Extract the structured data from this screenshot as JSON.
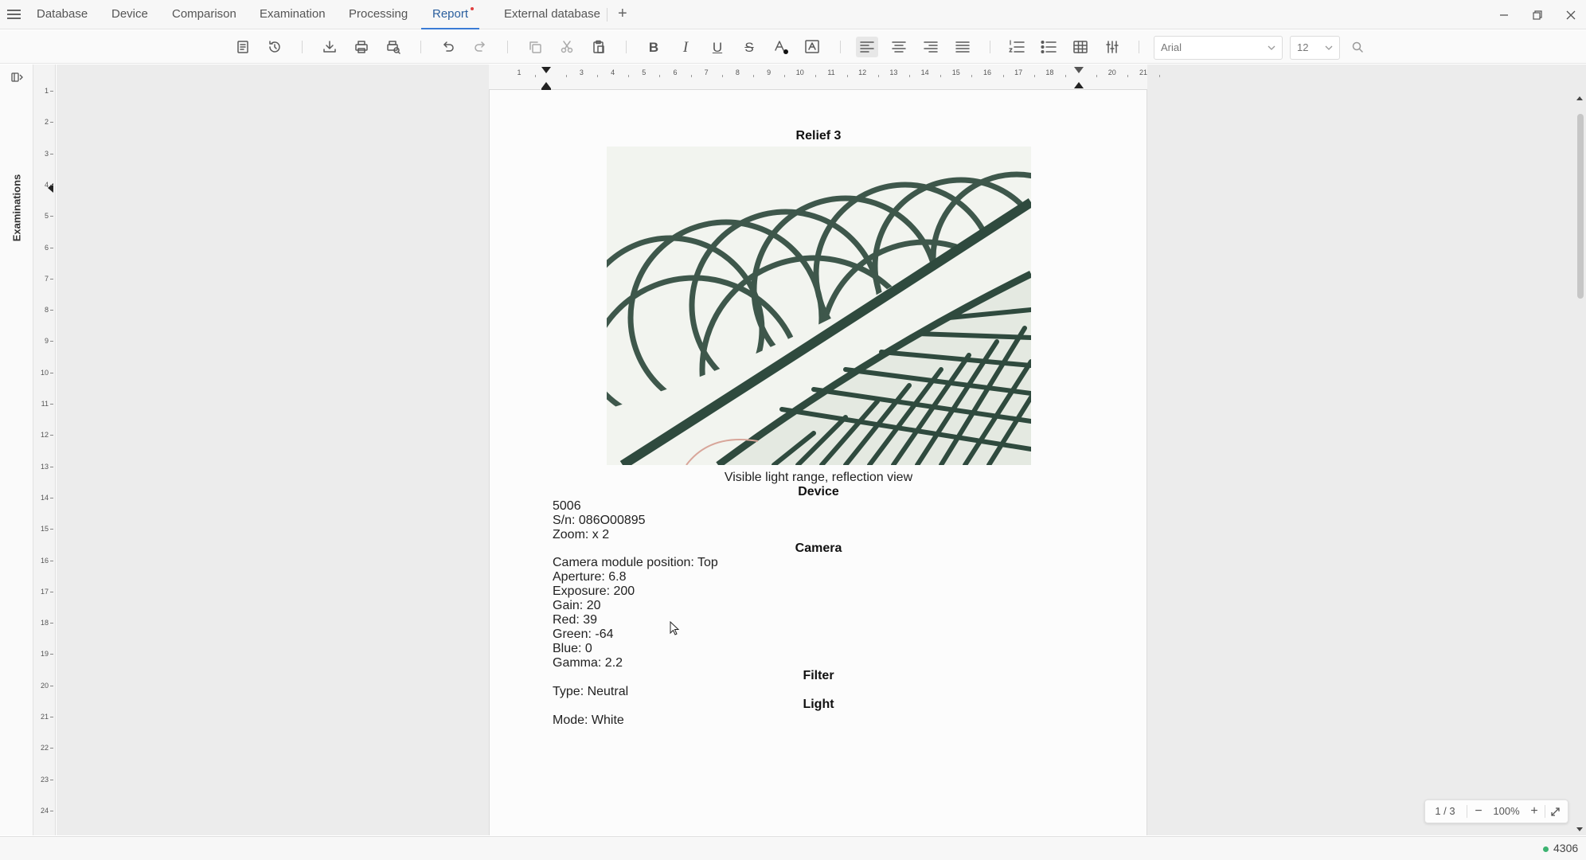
{
  "tabs": [
    {
      "label": "Database"
    },
    {
      "label": "Device"
    },
    {
      "label": "Comparison"
    },
    {
      "label": "Examination"
    },
    {
      "label": "Processing"
    },
    {
      "label": "Report",
      "active": true,
      "modified": true
    },
    {
      "label": "External database"
    }
  ],
  "toolbar": {
    "font_family": "Arial",
    "font_size": "12",
    "icons": [
      "page-icon",
      "history-icon",
      "download-icon",
      "print-icon",
      "print-preview-icon",
      "undo-icon",
      "redo-icon",
      "copy-icon",
      "cut-icon",
      "paste-icon",
      "bold-icon",
      "italic-icon",
      "underline-icon",
      "strikethrough-icon",
      "font-color-icon",
      "text-box-icon",
      "align-left-icon",
      "align-center-icon",
      "align-right-icon",
      "justify-icon",
      "numbered-list-icon",
      "bullet-list-icon",
      "table-icon",
      "settings-sliders-icon",
      "search-icon"
    ]
  },
  "sidebar": {
    "tab_label": "Examinations"
  },
  "ruler": {
    "horizontal": [
      "1",
      "3",
      "4",
      "5",
      "6",
      "7",
      "8",
      "9",
      "10",
      "11",
      "12",
      "13",
      "14",
      "15",
      "16",
      "17",
      "18",
      "20",
      "21"
    ],
    "vertical": [
      "1",
      "2",
      "3",
      "4",
      "5",
      "6",
      "7",
      "8",
      "9",
      "10",
      "11",
      "12",
      "13",
      "14",
      "15",
      "16",
      "17",
      "18",
      "19",
      "20",
      "21",
      "22",
      "23",
      "24"
    ]
  },
  "document": {
    "title": "Relief 3",
    "image_caption": "Visible light range, reflection view",
    "device": {
      "heading": "Device",
      "lines": [
        "5006",
        "S/n: 086O00895",
        "Zoom: x 2"
      ]
    },
    "camera": {
      "heading": "Camera",
      "lines": [
        "Camera module position: Top",
        "Aperture: 6.8",
        "Exposure: 200",
        "Gain: 20",
        "Red: 39",
        "Green: -64",
        "Blue: 0",
        "Gamma: 2.2"
      ]
    },
    "filter": {
      "heading": "Filter",
      "lines": [
        "Type: Neutral"
      ]
    },
    "light": {
      "heading": "Light",
      "lines": [
        "Mode: White"
      ]
    }
  },
  "zoom": {
    "page_indicator": "1 / 3",
    "minus": "−",
    "level": "100%",
    "plus": "+"
  },
  "status": {
    "count": "4306",
    "color": "#3cb371"
  },
  "colors": {
    "accent": "#3a7bd5",
    "modified_dot": "#e04040",
    "pattern_ink": "#2f4a3e"
  }
}
